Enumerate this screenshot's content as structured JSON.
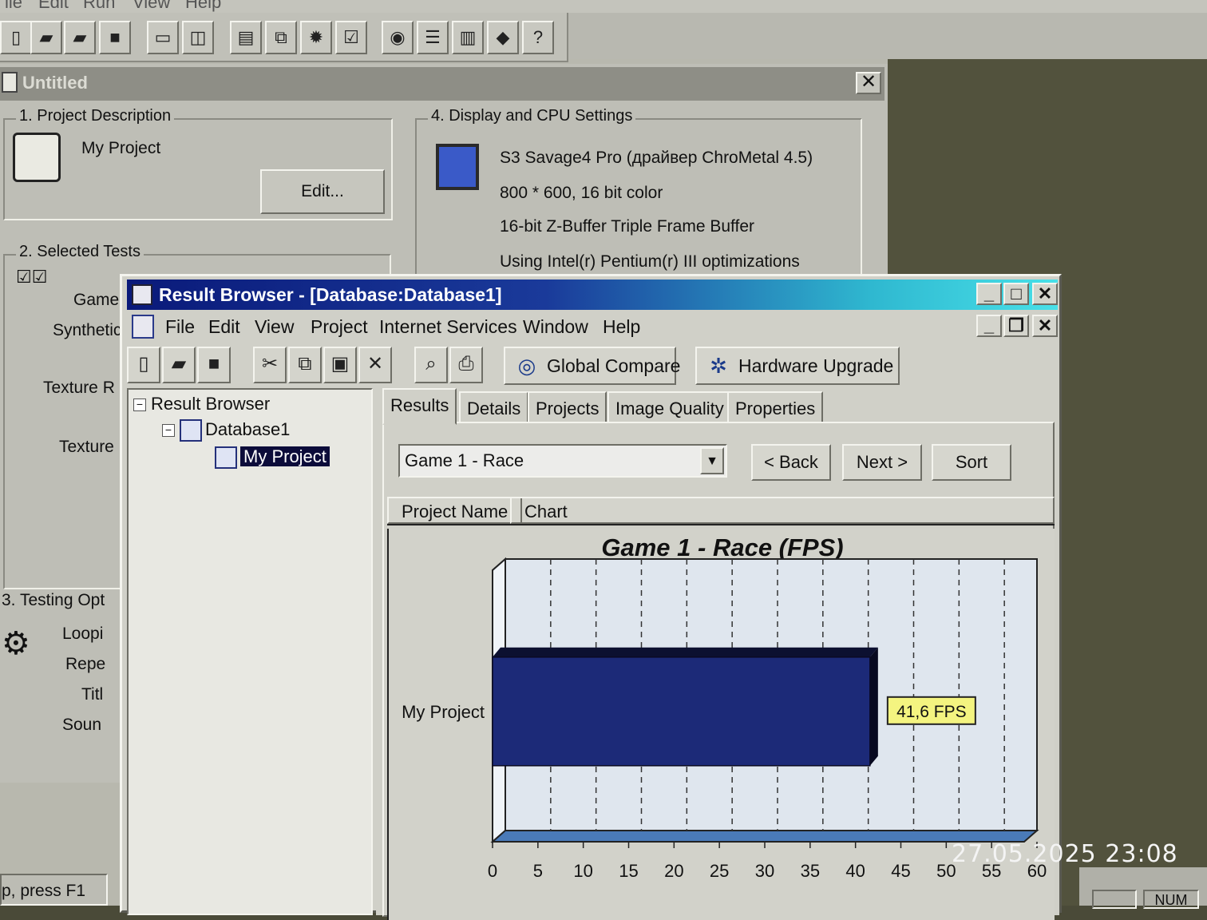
{
  "background_app": {
    "menu": [
      "ile",
      "Edit",
      "Run",
      "View",
      "Help"
    ],
    "toolbar_icons": [
      "new-file-icon",
      "open-folder-icon",
      "open-project-icon",
      "save-icon",
      "computer-icon",
      "scan-icon",
      "document-icon",
      "network-icon",
      "settings-gear-icon",
      "check-icon",
      "disc-icon",
      "list-icon",
      "book-icon",
      "eraser-icon",
      "help-icon"
    ],
    "window": {
      "title": "Untitled",
      "close_label": "✕",
      "group1": {
        "label": "1. Project Description",
        "project_name": "My Project",
        "edit_button": "Edit..."
      },
      "group2": {
        "label": "2. Selected Tests",
        "items": [
          "Game",
          "Synthetic",
          "Texture R",
          "Texture"
        ]
      },
      "group3": {
        "label": "3. Testing Opt",
        "items": [
          "Loopi",
          "Repe",
          "Titl",
          "Soun"
        ]
      },
      "group4": {
        "label": "4. Display and CPU Settings",
        "lines": [
          "S3 Savage4 Pro (драйвер ChroMetal 4.5)",
          "800 * 600, 16 bit color",
          "16-bit Z-Buffer  Triple Frame Buffer",
          "Using  Intel(r) Pentium(r) III optimizations"
        ]
      }
    },
    "status_left": "p, press F1",
    "status_right": "NUM"
  },
  "result_browser": {
    "title": "Result Browser - [Database:Database1]",
    "caption_buttons": {
      "minimize": "_",
      "maximize": "□",
      "close": "✕"
    },
    "mdi_buttons": {
      "minimize": "_",
      "restore": "❐",
      "close": "✕"
    },
    "menu": [
      "File",
      "Edit",
      "View",
      "Project",
      "Internet Services",
      "Window",
      "Help"
    ],
    "toolbar": {
      "icons": [
        "new-icon",
        "open-icon",
        "save-icon",
        "cut-icon",
        "copy-icon",
        "paste-icon",
        "delete-icon",
        "print-preview-icon",
        "print-icon"
      ],
      "global_compare": "Global Compare",
      "hardware_upgrade": "Hardware Upgrade"
    },
    "tree": {
      "root": "Result Browser",
      "database": "Database1",
      "project": "My Project"
    },
    "tabs": [
      "Results",
      "Details",
      "Projects",
      "Image Quality",
      "Properties"
    ],
    "active_tab": "Results",
    "test_select": {
      "value": "Game 1 - Race"
    },
    "nav": {
      "back": "< Back",
      "next": "Next >",
      "sort": "Sort"
    },
    "grid_columns": [
      "Project Name",
      "Chart"
    ]
  },
  "chart_data": {
    "type": "bar",
    "orientation": "horizontal",
    "title": "Game 1 - Race (FPS)",
    "categories": [
      "My Project"
    ],
    "values": [
      41.6
    ],
    "value_label": "41,6 FPS",
    "xlim": [
      0,
      60
    ],
    "x_ticks": [
      "0",
      "5",
      "10",
      "15",
      "20",
      "25",
      "30",
      "35",
      "40",
      "45",
      "50",
      "55",
      "60"
    ],
    "grid": true,
    "colors": {
      "bar": "#1c2a78",
      "plot_bg": "#dfe6ee",
      "label_bg": "#f4f480"
    }
  },
  "timestamp": "27.05.2025 23:08"
}
